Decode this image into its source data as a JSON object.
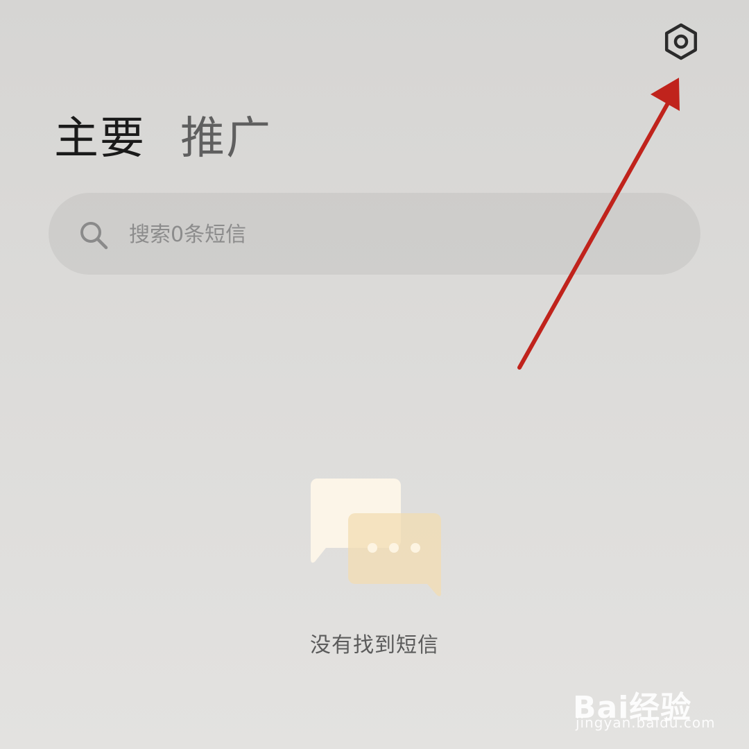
{
  "header": {
    "settings_icon": "hexagon-gear-icon"
  },
  "tabs": [
    {
      "label": "主要",
      "active": true
    },
    {
      "label": "推广",
      "active": false
    }
  ],
  "search": {
    "placeholder": "搜索0条短信",
    "icon": "search-icon"
  },
  "empty_state": {
    "icon": "chat-bubbles-icon",
    "message": "没有找到短信"
  },
  "annotation": {
    "color": "#c0231c",
    "target": "settings"
  },
  "watermark": {
    "brand": "Bai经验",
    "url": "jingyan.baidu.com"
  },
  "colors": {
    "background": "#d9d8d6",
    "active_tab": "#1a1a1a",
    "inactive_tab": "#5f5f5f",
    "bubble_back": "#fdf6e8",
    "bubble_front": "#f3ddb0"
  }
}
